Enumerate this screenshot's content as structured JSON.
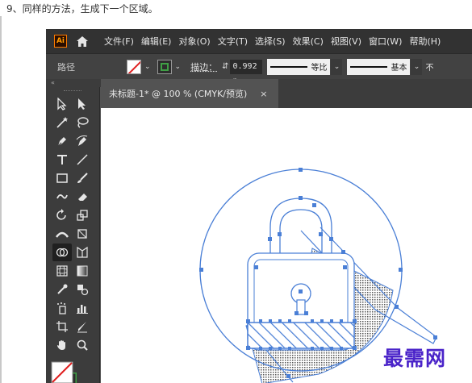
{
  "caption": "9、同样的方法，生成下一个区域。",
  "app": {
    "logo": "Ai",
    "menus": [
      "文件(F)",
      "编辑(E)",
      "对象(O)",
      "文字(T)",
      "选择(S)",
      "效果(C)",
      "视图(V)",
      "窗口(W)",
      "帮助(H)"
    ]
  },
  "controlbar": {
    "selection_label": "路径",
    "stroke_label": "描边：",
    "stroke_value": "0.992 p",
    "profile_label": "等比",
    "brush_label": "基本",
    "overflow_label": "不"
  },
  "document": {
    "tab_title": "未标题-1* @ 100 % (CMYK/预览)",
    "close_glyph": "×"
  },
  "watermark": "最需网",
  "colors": {
    "accent_blue": "#4a7fd6",
    "watermark": "#4a23c9",
    "stroke_green": "#3fa045"
  },
  "icons": [
    "home-icon",
    "selection-tool-icon",
    "direct-selection-tool-icon",
    "magic-wand-tool-icon",
    "lasso-tool-icon",
    "pen-tool-icon",
    "curvature-tool-icon",
    "type-tool-icon",
    "line-tool-icon",
    "rectangle-tool-icon",
    "paintbrush-tool-icon",
    "shaper-tool-icon",
    "eraser-tool-icon",
    "rotate-tool-icon",
    "scale-tool-icon",
    "width-tool-icon",
    "free-transform-tool-icon",
    "shape-builder-tool-icon",
    "perspective-grid-tool-icon",
    "mesh-tool-icon",
    "gradient-tool-icon",
    "eyedropper-tool-icon",
    "blend-tool-icon",
    "symbol-sprayer-tool-icon",
    "column-graph-tool-icon",
    "artboard-tool-icon",
    "slice-tool-icon",
    "hand-tool-icon",
    "zoom-tool-icon"
  ]
}
